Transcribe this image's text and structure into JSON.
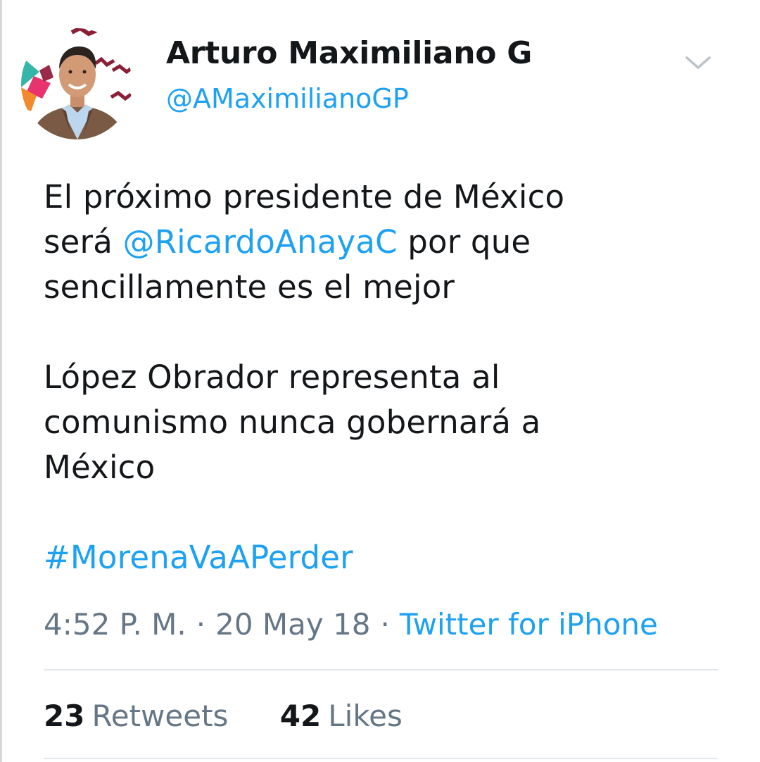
{
  "profile": {
    "display_name": "Arturo Maximiliano G",
    "handle": "@AMaximilianoGP",
    "avatar_icon": "profile-photo-icon"
  },
  "menu": {
    "icon": "chevron-down-icon"
  },
  "tweet": {
    "line1": "El próximo presidente de México",
    "line2_prefix": "será ",
    "mention": "@RicardoAnayaC",
    "line2_suffix": " por que",
    "line3": "sencillamente es el mejor",
    "line4": "López Obrador representa al",
    "line5": "comunismo nunca gobernará a",
    "line6": "México",
    "hashtag": "#MorenaVaAPerder"
  },
  "meta": {
    "time": "4:52 P. M.",
    "separator": "·",
    "date": "20 May 18",
    "source": "Twitter for iPhone"
  },
  "stats": {
    "retweets_count": "23",
    "retweets_label": "Retweets",
    "likes_count": "42",
    "likes_label": "Likes"
  },
  "colors": {
    "link": "#1da1f2",
    "text": "#14171a",
    "muted": "#657786",
    "divider": "#e1e8ed"
  }
}
